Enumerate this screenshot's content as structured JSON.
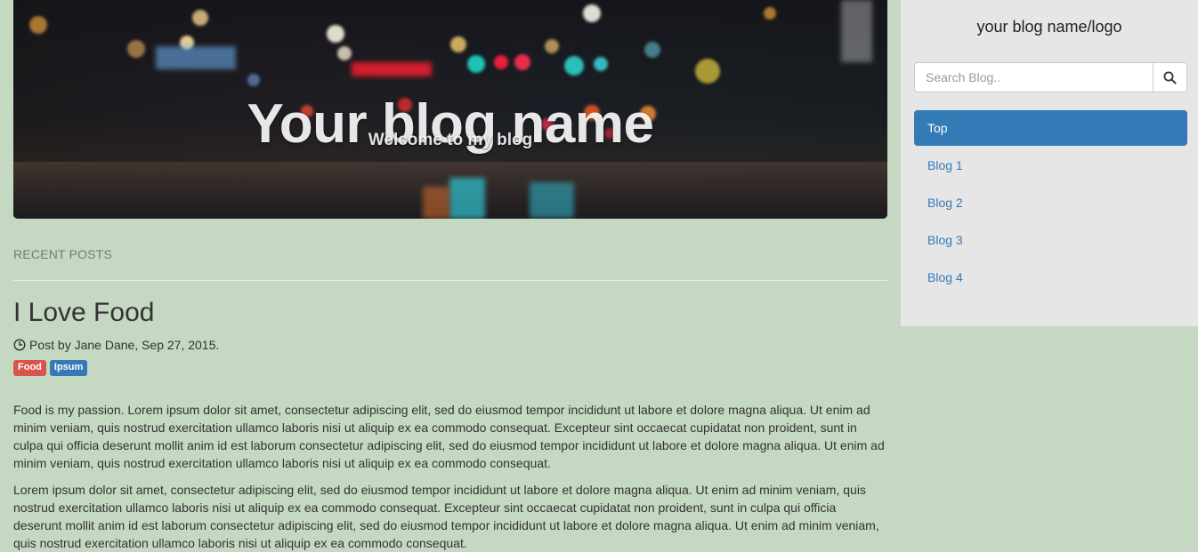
{
  "hero": {
    "title": "Your blog name",
    "subtitle": "Welcome to my blog"
  },
  "main": {
    "section_label": "RECENT POSTS",
    "post": {
      "title": "I Love Food",
      "meta": "Post by Jane Dane, Sep 27, 2015.",
      "tags": [
        {
          "label": "Food",
          "color": "#d9534f"
        },
        {
          "label": "Ipsum",
          "color": "#337ab7"
        }
      ],
      "paragraphs": [
        "Food is my passion. Lorem ipsum dolor sit amet, consectetur adipiscing elit, sed do eiusmod tempor incididunt ut labore et dolore magna aliqua. Ut enim ad minim veniam, quis nostrud exercitation ullamco laboris nisi ut aliquip ex ea commodo consequat. Excepteur sint occaecat cupidatat non proident, sunt in culpa qui officia deserunt mollit anim id est laborum consectetur adipiscing elit, sed do eiusmod tempor incididunt ut labore et dolore magna aliqua. Ut enim ad minim veniam, quis nostrud exercitation ullamco laboris nisi ut aliquip ex ea commodo consequat.",
        "Lorem ipsum dolor sit amet, consectetur adipiscing elit, sed do eiusmod tempor incididunt ut labore et dolore magna aliqua. Ut enim ad minim veniam, quis nostrud exercitation ullamco laboris nisi ut aliquip ex ea commodo consequat. Excepteur sint occaecat cupidatat non proident, sunt in culpa qui officia deserunt mollit anim id est laborum consectetur adipiscing elit, sed do eiusmod tempor incididunt ut labore et dolore magna aliqua. Ut enim ad minim veniam, quis nostrud exercitation ullamco laboris nisi ut aliquip ex ea commodo consequat."
      ]
    }
  },
  "sidebar": {
    "logo": "your blog name/logo",
    "search": {
      "placeholder": "Search Blog..",
      "icon": "search-icon"
    },
    "nav": [
      {
        "label": "Top",
        "active": true
      },
      {
        "label": "Blog 1",
        "active": false
      },
      {
        "label": "Blog 2",
        "active": false
      },
      {
        "label": "Blog 3",
        "active": false
      },
      {
        "label": "Blog 4",
        "active": false
      }
    ]
  },
  "colors": {
    "page_background": "#c5d8c1",
    "sidebar_background": "#e6e6e6",
    "accent": "#337ab7",
    "danger": "#d9534f"
  }
}
